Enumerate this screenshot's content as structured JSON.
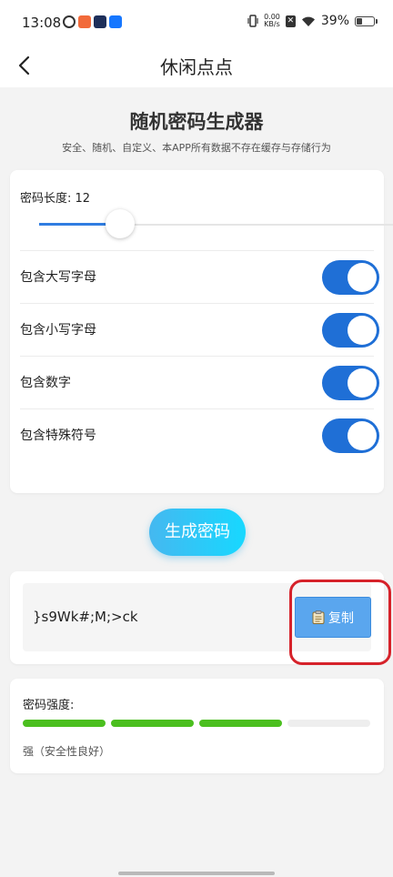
{
  "status_bar": {
    "time": "13:08",
    "net_speed_value": "0.00",
    "net_speed_unit": "KB/s",
    "battery": "39%"
  },
  "nav": {
    "title": "休闲点点"
  },
  "header": {
    "title": "随机密码生成器",
    "subtitle": "安全、随机、自定义、本APP所有数据不存在缓存与存储行为"
  },
  "options": {
    "length_label": "密码长度: 12",
    "length_value": 12,
    "toggles": [
      {
        "label": "包含大写字母",
        "on": true
      },
      {
        "label": "包含小写字母",
        "on": true
      },
      {
        "label": "包含数字",
        "on": true
      },
      {
        "label": "包含特殊符号",
        "on": true
      }
    ]
  },
  "generate_label": "生成密码",
  "result": {
    "password": "}s9Wk#;M;>ck",
    "copy_label": "复制"
  },
  "strength": {
    "label": "密码强度:",
    "level": 3,
    "max_level": 4,
    "description": "强（安全性良好）"
  },
  "colors": {
    "accent": "#1f6fd6",
    "strength": "#4bbf1f",
    "highlight": "#d6222a"
  }
}
